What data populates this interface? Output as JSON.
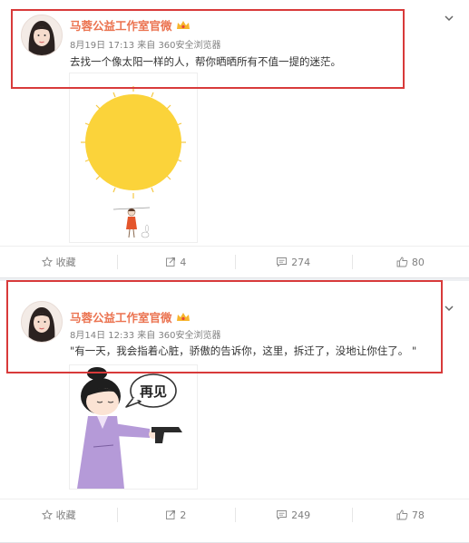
{
  "posts": [
    {
      "author": "马蓉公益工作室官微",
      "meta": "8月19日 17:13 来自 360安全浏览器",
      "text": "去找一个像太阳一样的人，帮你晒晒所有不值一提的迷茫。",
      "actions": {
        "favorite": "收藏",
        "repost": "4",
        "comment": "274",
        "like": "80"
      }
    },
    {
      "author": "马蓉公益工作室官微",
      "meta": "8月14日 12:33 来自 360安全浏览器",
      "text": "\"有一天，我会指着心脏，骄傲的告诉你，这里，拆迁了，没地让你住了。 \"",
      "image_speech": "再见",
      "actions": {
        "favorite": "收藏",
        "repost": "2",
        "comment": "249",
        "like": "78"
      }
    }
  ],
  "colors": {
    "name": "#eb7350",
    "highlight_box": "#d83a3a",
    "sun": "#fbd33a"
  },
  "icons": [
    "chevron-down-icon",
    "star-icon",
    "repost-icon",
    "comment-icon",
    "like-icon",
    "vip-crown-icon"
  ]
}
